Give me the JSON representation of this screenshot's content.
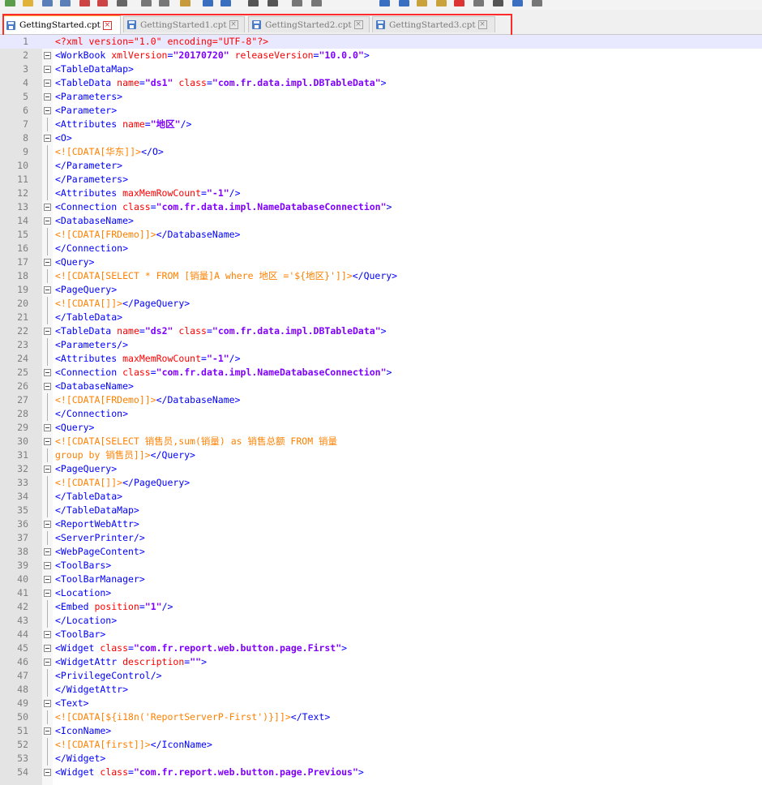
{
  "colors": {
    "tag": "#0000ff",
    "attribute": "#ff0000",
    "value": "#8000ff",
    "cdata": "#ff8000",
    "highlight_box": "#ff2a2a",
    "active_tab_accent": "#f6a641"
  },
  "toolbar": {
    "icons": [
      "new-file-icon",
      "open-folder-icon",
      "save-icon",
      "save-all-icon",
      "close-icon",
      "close-all-icon",
      "print-icon",
      "cut-icon",
      "copy-icon",
      "paste-icon",
      "undo-icon",
      "redo-icon",
      "find-icon",
      "replace-icon",
      "zoom-in-icon",
      "zoom-out-icon",
      "sync-scroll-icon",
      "word-wrap-icon",
      "show-all-chars-icon",
      "indent-guide-icon",
      "macro-record-icon",
      "macro-stop-icon",
      "macro-play-icon",
      "macro-run-multiple-icon",
      "macro-save-icon"
    ]
  },
  "tabs": [
    {
      "label": "GettingStarted.cpt",
      "active": true
    },
    {
      "label": "GettingStarted1.cpt",
      "active": false
    },
    {
      "label": "GettingStarted2.cpt",
      "active": false
    },
    {
      "label": "GettingStarted3.cpt",
      "active": false
    }
  ],
  "editor": {
    "current_line": 1,
    "lines": [
      {
        "n": "1",
        "fold": false,
        "tokens": [
          {
            "t": "decl",
            "v": "<?xml version=\"1.0\" encoding=\"UTF-8\"?>"
          }
        ]
      },
      {
        "n": "2",
        "fold": true,
        "tokens": [
          {
            "t": "tag",
            "v": "<WorkBook "
          },
          {
            "t": "attr",
            "v": "xmlVersion"
          },
          {
            "t": "tag",
            "v": "="
          },
          {
            "t": "val",
            "v": "\"20170720\""
          },
          {
            "t": "attr",
            "v": " releaseVersion"
          },
          {
            "t": "tag",
            "v": "="
          },
          {
            "t": "val",
            "v": "\"10.0.0\""
          },
          {
            "t": "tag",
            "v": ">"
          }
        ]
      },
      {
        "n": "3",
        "fold": true,
        "tokens": [
          {
            "t": "tag",
            "v": "<TableDataMap>"
          }
        ]
      },
      {
        "n": "4",
        "fold": true,
        "tokens": [
          {
            "t": "tag",
            "v": "<TableData "
          },
          {
            "t": "attr",
            "v": "name"
          },
          {
            "t": "tag",
            "v": "="
          },
          {
            "t": "val",
            "v": "\"ds1\""
          },
          {
            "t": "attr",
            "v": " class"
          },
          {
            "t": "tag",
            "v": "="
          },
          {
            "t": "val",
            "v": "\"com.fr.data.impl.DBTableData\""
          },
          {
            "t": "tag",
            "v": ">"
          }
        ]
      },
      {
        "n": "5",
        "fold": true,
        "tokens": [
          {
            "t": "tag",
            "v": "<Parameters>"
          }
        ]
      },
      {
        "n": "6",
        "fold": true,
        "tokens": [
          {
            "t": "tag",
            "v": "<Parameter>"
          }
        ]
      },
      {
        "n": "7",
        "fold": false,
        "tokens": [
          {
            "t": "tag",
            "v": "<Attributes "
          },
          {
            "t": "attr",
            "v": "name"
          },
          {
            "t": "tag",
            "v": "="
          },
          {
            "t": "val",
            "v": "\"地区\""
          },
          {
            "t": "tag",
            "v": "/>"
          }
        ]
      },
      {
        "n": "8",
        "fold": true,
        "tokens": [
          {
            "t": "tag",
            "v": "<O>"
          }
        ]
      },
      {
        "n": "9",
        "fold": false,
        "tokens": [
          {
            "t": "cdata",
            "v": "<![CDATA[华东]]>"
          },
          {
            "t": "tag",
            "v": "</O>"
          }
        ]
      },
      {
        "n": "10",
        "fold": false,
        "tokens": [
          {
            "t": "tag",
            "v": "</Parameter>"
          }
        ]
      },
      {
        "n": "11",
        "fold": false,
        "tokens": [
          {
            "t": "tag",
            "v": "</Parameters>"
          }
        ]
      },
      {
        "n": "12",
        "fold": false,
        "tokens": [
          {
            "t": "tag",
            "v": "<Attributes "
          },
          {
            "t": "attr",
            "v": "maxMemRowCount"
          },
          {
            "t": "tag",
            "v": "="
          },
          {
            "t": "val",
            "v": "\"-1\""
          },
          {
            "t": "tag",
            "v": "/>"
          }
        ]
      },
      {
        "n": "13",
        "fold": true,
        "tokens": [
          {
            "t": "tag",
            "v": "<Connection "
          },
          {
            "t": "attr",
            "v": "class"
          },
          {
            "t": "tag",
            "v": "="
          },
          {
            "t": "val",
            "v": "\"com.fr.data.impl.NameDatabaseConnection\""
          },
          {
            "t": "tag",
            "v": ">"
          }
        ]
      },
      {
        "n": "14",
        "fold": true,
        "tokens": [
          {
            "t": "tag",
            "v": "<DatabaseName>"
          }
        ]
      },
      {
        "n": "15",
        "fold": false,
        "tokens": [
          {
            "t": "cdata",
            "v": "<![CDATA[FRDemo]]>"
          },
          {
            "t": "tag",
            "v": "</DatabaseName>"
          }
        ]
      },
      {
        "n": "16",
        "fold": false,
        "tokens": [
          {
            "t": "tag",
            "v": "</Connection>"
          }
        ]
      },
      {
        "n": "17",
        "fold": true,
        "tokens": [
          {
            "t": "tag",
            "v": "<Query>"
          }
        ]
      },
      {
        "n": "18",
        "fold": false,
        "tokens": [
          {
            "t": "cdata",
            "v": "<![CDATA[SELECT * FROM [销量]A where 地区 ='${地区}']]>"
          },
          {
            "t": "tag",
            "v": "</Query>"
          }
        ]
      },
      {
        "n": "19",
        "fold": true,
        "tokens": [
          {
            "t": "tag",
            "v": "<PageQuery>"
          }
        ]
      },
      {
        "n": "20",
        "fold": false,
        "tokens": [
          {
            "t": "cdata",
            "v": "<![CDATA[]]>"
          },
          {
            "t": "tag",
            "v": "</PageQuery>"
          }
        ]
      },
      {
        "n": "21",
        "fold": false,
        "tokens": [
          {
            "t": "tag",
            "v": "</TableData>"
          }
        ]
      },
      {
        "n": "22",
        "fold": true,
        "tokens": [
          {
            "t": "tag",
            "v": "<TableData "
          },
          {
            "t": "attr",
            "v": "name"
          },
          {
            "t": "tag",
            "v": "="
          },
          {
            "t": "val",
            "v": "\"ds2\""
          },
          {
            "t": "attr",
            "v": " class"
          },
          {
            "t": "tag",
            "v": "="
          },
          {
            "t": "val",
            "v": "\"com.fr.data.impl.DBTableData\""
          },
          {
            "t": "tag",
            "v": ">"
          }
        ]
      },
      {
        "n": "23",
        "fold": false,
        "tokens": [
          {
            "t": "tag",
            "v": "<Parameters/>"
          }
        ]
      },
      {
        "n": "24",
        "fold": false,
        "tokens": [
          {
            "t": "tag",
            "v": "<Attributes "
          },
          {
            "t": "attr",
            "v": "maxMemRowCount"
          },
          {
            "t": "tag",
            "v": "="
          },
          {
            "t": "val",
            "v": "\"-1\""
          },
          {
            "t": "tag",
            "v": "/>"
          }
        ]
      },
      {
        "n": "25",
        "fold": true,
        "tokens": [
          {
            "t": "tag",
            "v": "<Connection "
          },
          {
            "t": "attr",
            "v": "class"
          },
          {
            "t": "tag",
            "v": "="
          },
          {
            "t": "val",
            "v": "\"com.fr.data.impl.NameDatabaseConnection\""
          },
          {
            "t": "tag",
            "v": ">"
          }
        ]
      },
      {
        "n": "26",
        "fold": true,
        "tokens": [
          {
            "t": "tag",
            "v": "<DatabaseName>"
          }
        ]
      },
      {
        "n": "27",
        "fold": false,
        "tokens": [
          {
            "t": "cdata",
            "v": "<![CDATA[FRDemo]]>"
          },
          {
            "t": "tag",
            "v": "</DatabaseName>"
          }
        ]
      },
      {
        "n": "28",
        "fold": false,
        "tokens": [
          {
            "t": "tag",
            "v": "</Connection>"
          }
        ]
      },
      {
        "n": "29",
        "fold": true,
        "tokens": [
          {
            "t": "tag",
            "v": "<Query>"
          }
        ]
      },
      {
        "n": "30",
        "fold": true,
        "tokens": [
          {
            "t": "cdata",
            "v": "<![CDATA[SELECT 销售员,sum(销量) as 销售总额 FROM 销量"
          }
        ]
      },
      {
        "n": "31",
        "fold": false,
        "tokens": [
          {
            "t": "cdata",
            "v": "group by 销售员]]>"
          },
          {
            "t": "tag",
            "v": "</Query>"
          }
        ]
      },
      {
        "n": "32",
        "fold": true,
        "tokens": [
          {
            "t": "tag",
            "v": "<PageQuery>"
          }
        ]
      },
      {
        "n": "33",
        "fold": false,
        "tokens": [
          {
            "t": "cdata",
            "v": "<![CDATA[]]>"
          },
          {
            "t": "tag",
            "v": "</PageQuery>"
          }
        ]
      },
      {
        "n": "34",
        "fold": false,
        "tokens": [
          {
            "t": "tag",
            "v": "</TableData>"
          }
        ]
      },
      {
        "n": "35",
        "fold": false,
        "tokens": [
          {
            "t": "tag",
            "v": "</TableDataMap>"
          }
        ]
      },
      {
        "n": "36",
        "fold": true,
        "tokens": [
          {
            "t": "tag",
            "v": "<ReportWebAttr>"
          }
        ]
      },
      {
        "n": "37",
        "fold": false,
        "tokens": [
          {
            "t": "tag",
            "v": "<ServerPrinter/>"
          }
        ]
      },
      {
        "n": "38",
        "fold": true,
        "tokens": [
          {
            "t": "tag",
            "v": "<WebPageContent>"
          }
        ]
      },
      {
        "n": "39",
        "fold": true,
        "tokens": [
          {
            "t": "tag",
            "v": "<ToolBars>"
          }
        ]
      },
      {
        "n": "40",
        "fold": true,
        "tokens": [
          {
            "t": "tag",
            "v": "<ToolBarManager>"
          }
        ]
      },
      {
        "n": "41",
        "fold": true,
        "tokens": [
          {
            "t": "tag",
            "v": "<Location>"
          }
        ]
      },
      {
        "n": "42",
        "fold": false,
        "tokens": [
          {
            "t": "tag",
            "v": "<Embed "
          },
          {
            "t": "attr",
            "v": "position"
          },
          {
            "t": "tag",
            "v": "="
          },
          {
            "t": "val",
            "v": "\"1\""
          },
          {
            "t": "tag",
            "v": "/>"
          }
        ]
      },
      {
        "n": "43",
        "fold": false,
        "tokens": [
          {
            "t": "tag",
            "v": "</Location>"
          }
        ]
      },
      {
        "n": "44",
        "fold": true,
        "tokens": [
          {
            "t": "tag",
            "v": "<ToolBar>"
          }
        ]
      },
      {
        "n": "45",
        "fold": true,
        "tokens": [
          {
            "t": "tag",
            "v": "<Widget "
          },
          {
            "t": "attr",
            "v": "class"
          },
          {
            "t": "tag",
            "v": "="
          },
          {
            "t": "val",
            "v": "\"com.fr.report.web.button.page.First\""
          },
          {
            "t": "tag",
            "v": ">"
          }
        ]
      },
      {
        "n": "46",
        "fold": true,
        "tokens": [
          {
            "t": "tag",
            "v": "<WidgetAttr "
          },
          {
            "t": "attr",
            "v": "description"
          },
          {
            "t": "tag",
            "v": "="
          },
          {
            "t": "val",
            "v": "\"\""
          },
          {
            "t": "tag",
            "v": ">"
          }
        ]
      },
      {
        "n": "47",
        "fold": false,
        "tokens": [
          {
            "t": "tag",
            "v": "<PrivilegeControl/>"
          }
        ]
      },
      {
        "n": "48",
        "fold": false,
        "tokens": [
          {
            "t": "tag",
            "v": "</WidgetAttr>"
          }
        ]
      },
      {
        "n": "49",
        "fold": true,
        "tokens": [
          {
            "t": "tag",
            "v": "<Text>"
          }
        ]
      },
      {
        "n": "50",
        "fold": false,
        "tokens": [
          {
            "t": "cdata",
            "v": "<![CDATA[${i18n('ReportServerP-First')}]]>"
          },
          {
            "t": "tag",
            "v": "</Text>"
          }
        ]
      },
      {
        "n": "51",
        "fold": true,
        "tokens": [
          {
            "t": "tag",
            "v": "<IconName>"
          }
        ]
      },
      {
        "n": "52",
        "fold": false,
        "tokens": [
          {
            "t": "cdata",
            "v": "<![CDATA[first]]>"
          },
          {
            "t": "tag",
            "v": "</IconName>"
          }
        ]
      },
      {
        "n": "53",
        "fold": false,
        "tokens": [
          {
            "t": "tag",
            "v": "</Widget>"
          }
        ]
      },
      {
        "n": "54",
        "fold": true,
        "tokens": [
          {
            "t": "tag",
            "v": "<Widget "
          },
          {
            "t": "attr",
            "v": "class"
          },
          {
            "t": "tag",
            "v": "="
          },
          {
            "t": "val",
            "v": "\"com.fr.report.web.button.page.Previous\""
          },
          {
            "t": "tag",
            "v": ">"
          }
        ]
      }
    ]
  }
}
